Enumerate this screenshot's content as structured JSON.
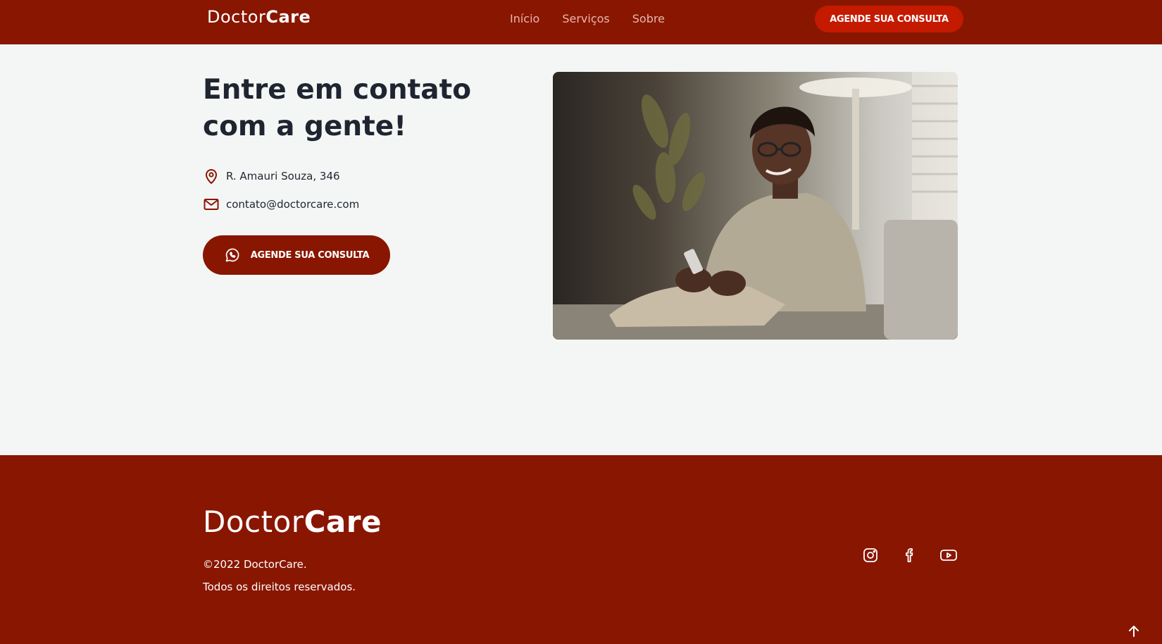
{
  "header": {
    "logo_regular": "Doctor",
    "logo_bold": "Care",
    "nav": [
      "Início",
      "Serviços",
      "Sobre"
    ],
    "cta_label": "AGENDE SUA CONSULTA"
  },
  "contact": {
    "title_line1": "Entre em contato",
    "title_line2": "com a gente!",
    "address": "R. Amauri Souza, 346",
    "email": "contato@doctorcare.com",
    "cta_label": "AGENDE SUA CONSULTA",
    "cta_icon": "whatsapp-icon",
    "address_icon": "map-pin-icon",
    "email_icon": "mail-icon"
  },
  "footer": {
    "logo_regular": "Doctor",
    "logo_bold": "Care",
    "copyright": "©2022 DoctorCare.",
    "rights": "Todos os direitos reservados.",
    "social_icons": [
      "instagram-icon",
      "facebook-icon",
      "youtube-icon"
    ],
    "back_to_top_icon": "arrow-up-icon"
  },
  "colors": {
    "brand": "#891600",
    "header_cta": "#c41a00",
    "background": "#f4f6f5",
    "heading": "#1f2530"
  }
}
